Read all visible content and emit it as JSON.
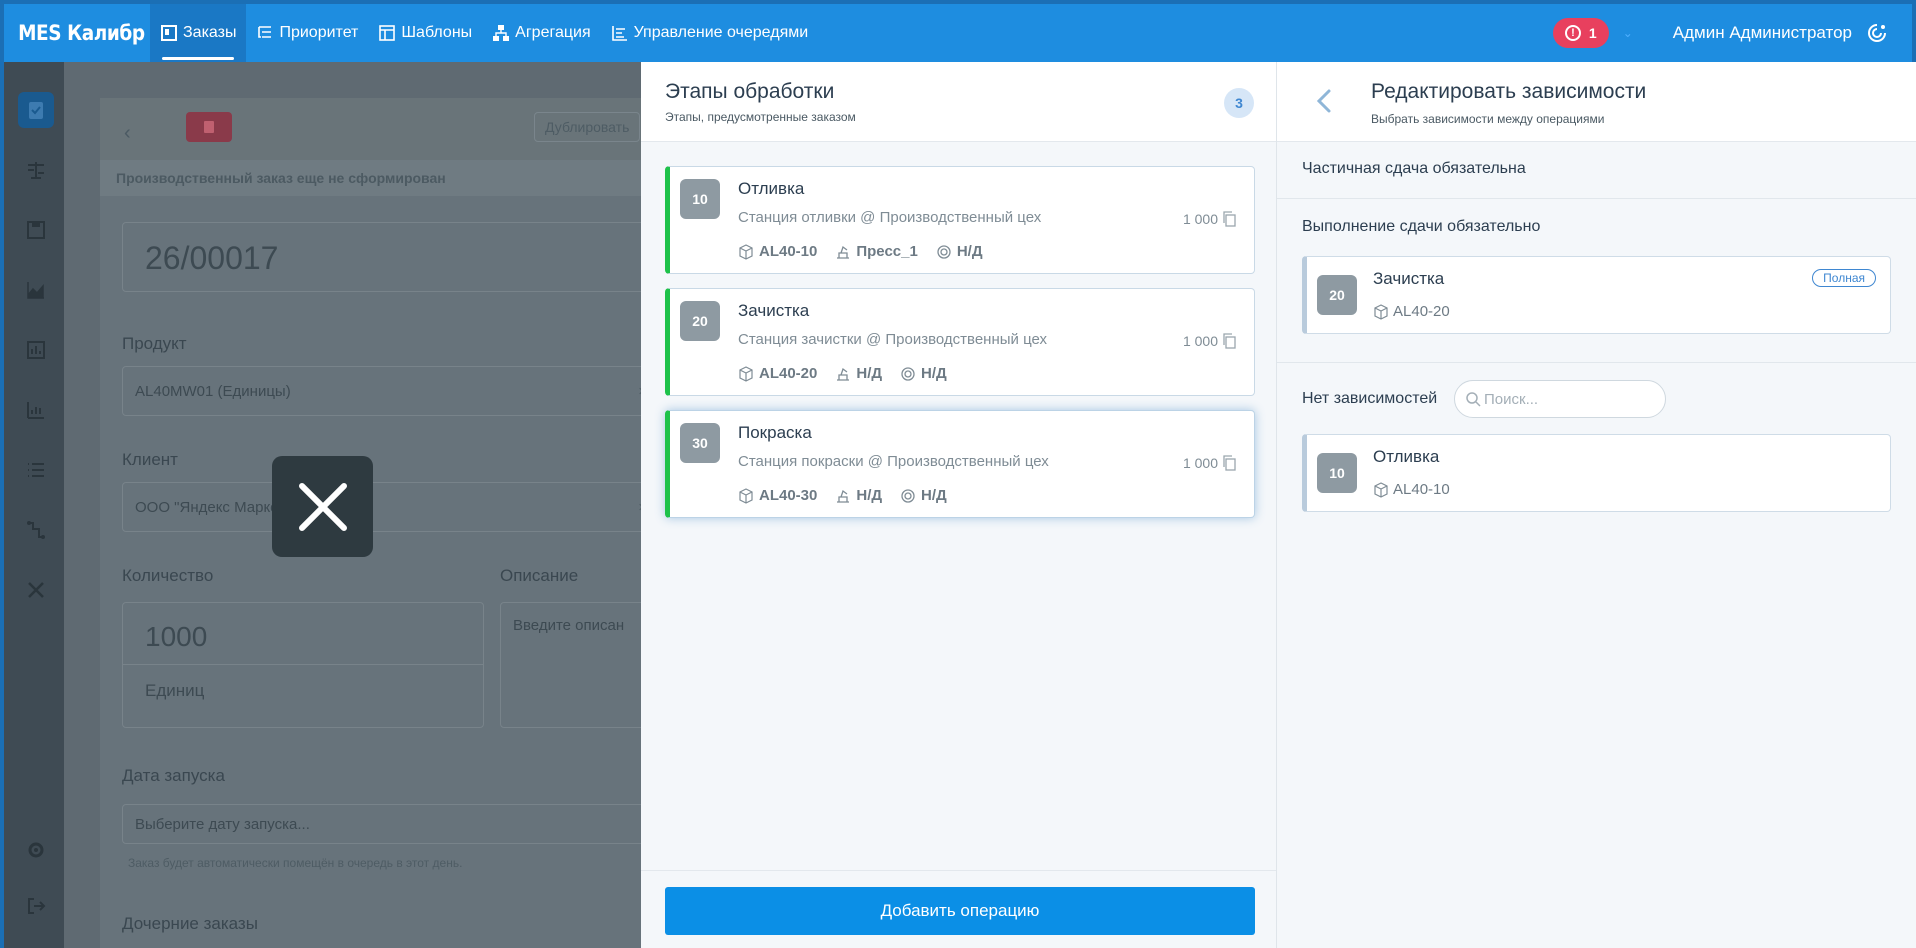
{
  "topbar": {
    "brand": "MES Калибр",
    "nav": [
      {
        "label": "Заказы",
        "icon": "orders-icon"
      },
      {
        "label": "Приоритет",
        "icon": "priority-icon"
      },
      {
        "label": "Шаблоны",
        "icon": "templates-icon"
      },
      {
        "label": "Агрегация",
        "icon": "aggregation-icon"
      },
      {
        "label": "Управление очередями",
        "icon": "queue-icon"
      }
    ],
    "alert_count": "1",
    "user_name": "Админ Администратор"
  },
  "background_form": {
    "duplicate_label": "Дублировать",
    "banner": "Производственный заказ еще не сформирован",
    "order_number": "26/00017",
    "product_label": "Продукт",
    "product_value": "AL40MW01 (Единицы)",
    "client_label": "Клиент",
    "client_value": "ООО \"Яндекс Марке",
    "quantity_label": "Количество",
    "quantity_value": "1000",
    "unit_value": "Единиц",
    "description_label": "Описание",
    "description_placeholder": "Введите описан",
    "start_date_label": "Дата запуска",
    "start_date_placeholder": "Выберите дату запуска...",
    "start_date_hint": "Заказ будет автоматически помещён в очередь в этот день.",
    "child_orders_label": "Дочерние заказы"
  },
  "stages_panel": {
    "title": "Этапы обработки",
    "subtitle": "Этапы, предусмотренные заказом",
    "count": "3",
    "operations": [
      {
        "num": "10",
        "name": "Отливка",
        "station": "Станция отливки @ Производственный цех",
        "qty": "1 000",
        "code": "AL40-10",
        "machine": "Пресс_1",
        "tool": "Н/Д"
      },
      {
        "num": "20",
        "name": "Зачистка",
        "station": "Станция зачистки @ Производственный цех",
        "qty": "1 000",
        "code": "AL40-20",
        "machine": "Н/Д",
        "tool": "Н/Д"
      },
      {
        "num": "30",
        "name": "Покраска",
        "station": "Станция покраски @ Производственный цех",
        "qty": "1 000",
        "code": "AL40-30",
        "machine": "Н/Д",
        "tool": "Н/Д"
      }
    ],
    "add_button": "Добавить операцию"
  },
  "deps_panel": {
    "title": "Редактировать зависимости",
    "subtitle": "Выбрать зависимости между операциями",
    "partial_label": "Частичная сдача обязательна",
    "required_label": "Выполнение сдачи обязательно",
    "required_items": [
      {
        "num": "20",
        "name": "Зачистка",
        "code": "AL40-20",
        "badge": "Полная"
      }
    ],
    "none_label": "Нет зависимостей",
    "search_placeholder": "Поиск...",
    "none_items": [
      {
        "num": "10",
        "name": "Отливка",
        "code": "AL40-10"
      }
    ]
  }
}
